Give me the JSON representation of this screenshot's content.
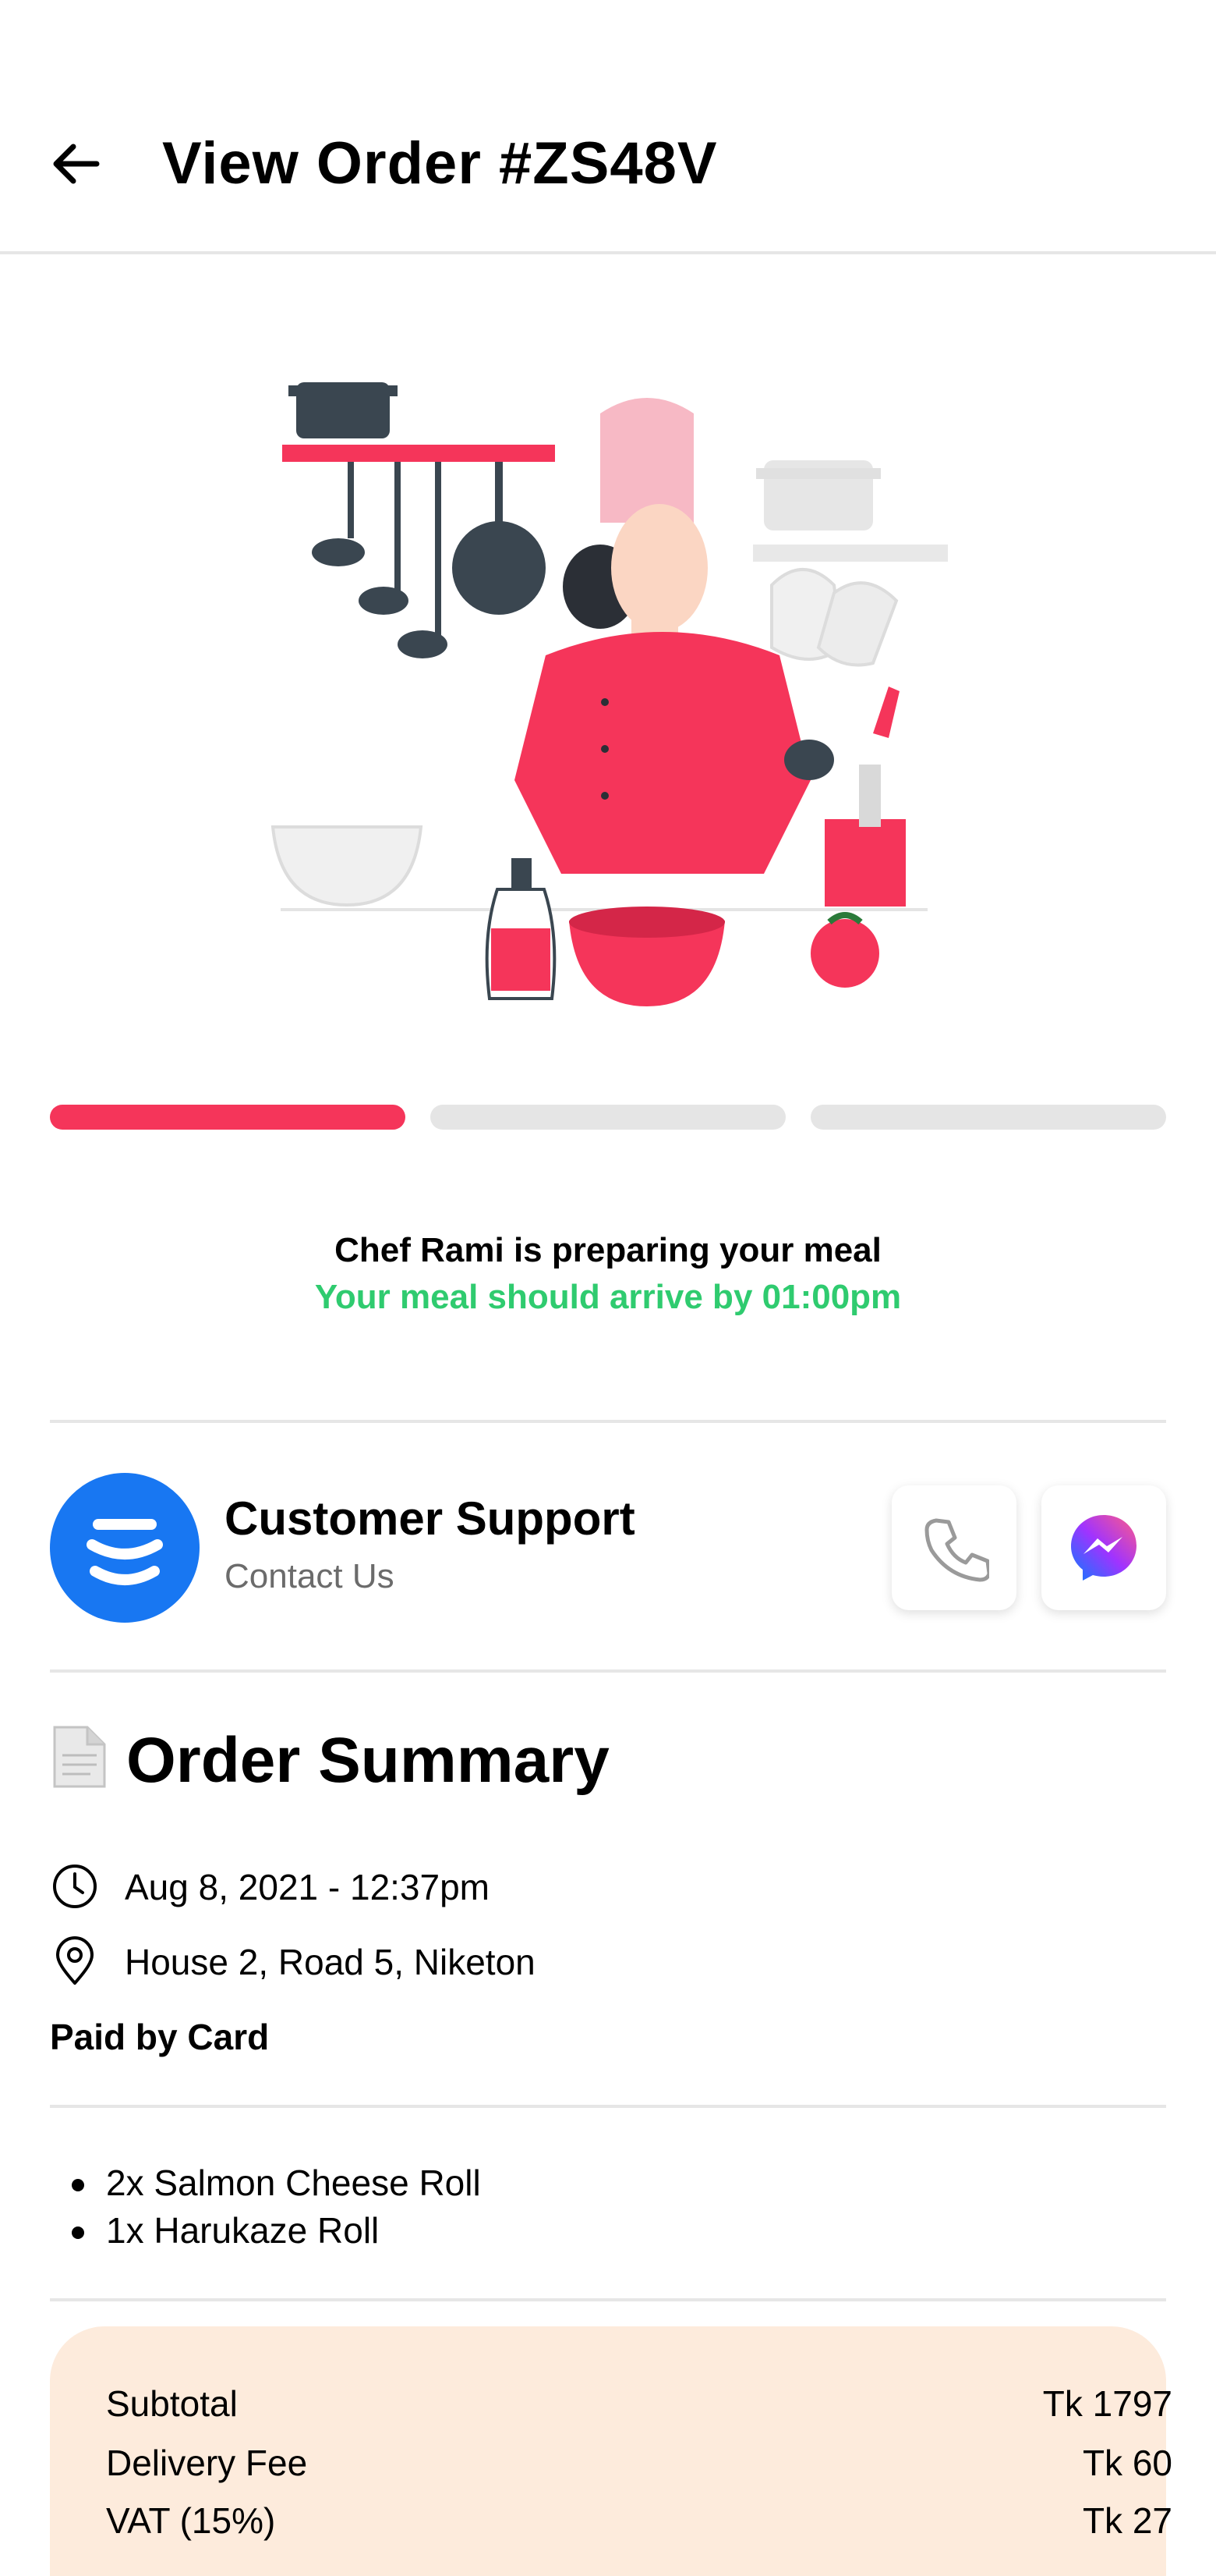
{
  "header": {
    "title": "View Order #ZS48V"
  },
  "progress": {
    "steps_total": 3,
    "steps_completed": 1
  },
  "status": {
    "line1": "Chef Rami is preparing your meal",
    "line2": "Your meal should arrive by 01:00pm",
    "line2_color": "#2fcb6f"
  },
  "support": {
    "title": "Customer Support",
    "subtitle": "Contact Us",
    "avatar_color": "#1877f2",
    "actions": [
      "phone-icon",
      "messenger-icon"
    ]
  },
  "summary": {
    "title": "Order Summary",
    "date": "Aug 8, 2021 - 12:37pm",
    "address": "House 2, Road 5, Niketon",
    "payment": "Paid by Card"
  },
  "items": [
    "2x Salmon Cheese Roll",
    "1x Harukaze Roll"
  ],
  "totals": [
    {
      "label": "Subtotal",
      "value": "Tk 1797"
    },
    {
      "label": "Delivery Fee",
      "value": "Tk 60"
    },
    {
      "label": "VAT (15%)",
      "value": "Tk 27"
    }
  ],
  "colors": {
    "accent": "#f5355a",
    "totals_bg": "#fdebdc"
  }
}
